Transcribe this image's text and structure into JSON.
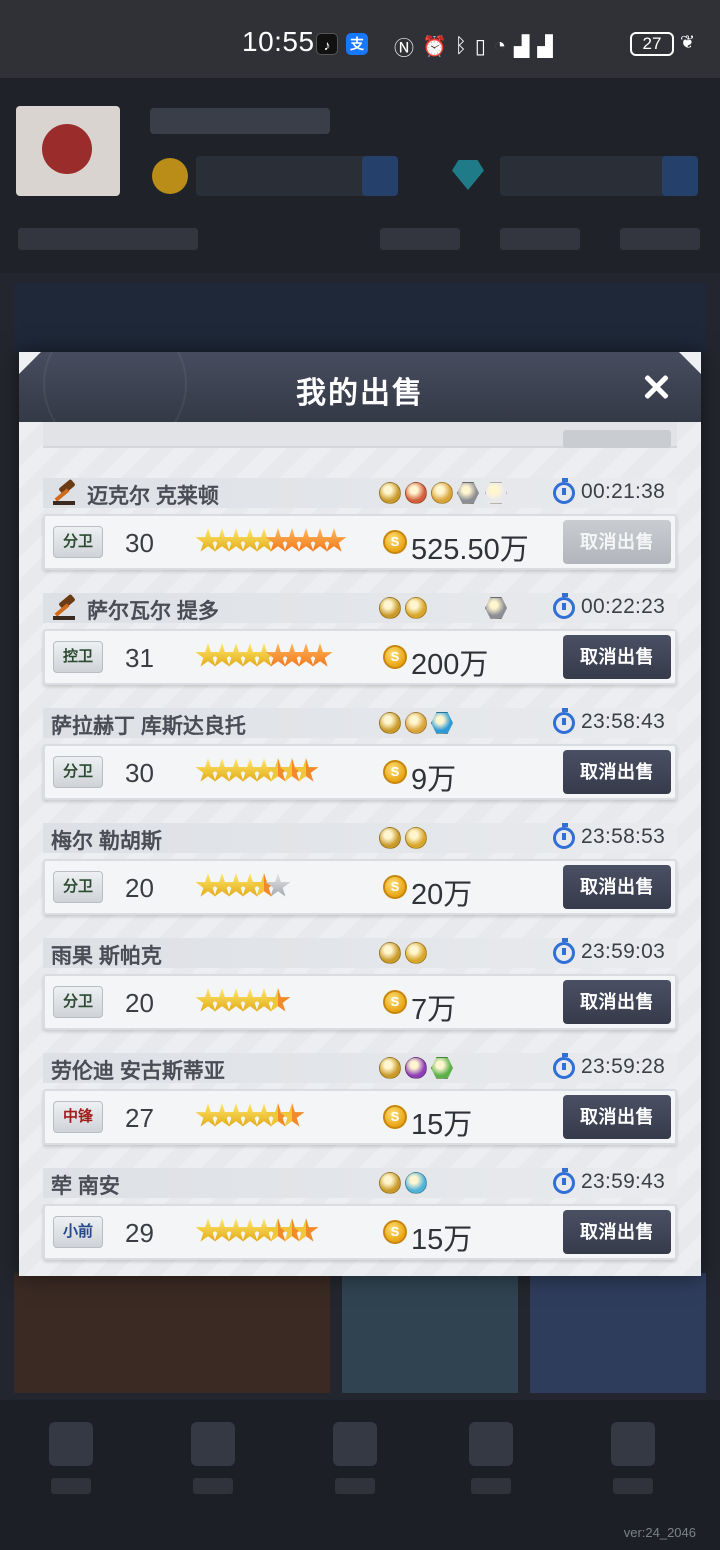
{
  "status_bar": {
    "time": "10:55",
    "battery": "27",
    "icons": [
      "nfc-icon",
      "alarm-icon",
      "bluetooth-icon",
      "vibrate-icon",
      "wifi-icon",
      "signal-5g-icon",
      "signal-icon"
    ]
  },
  "modal": {
    "title": "我的出售",
    "close_icon": "close-icon"
  },
  "listings": [
    {
      "name": "迈克尔 克莱顿",
      "auction": true,
      "badges": [
        "#c99a2a",
        "#d35d3a",
        "#d9a43a",
        "#8b8e94",
        "#e9e9ec"
      ],
      "time": "00:21:38",
      "position": "分卫",
      "position_color": "green",
      "level": "30",
      "stars": [
        "gold",
        "gold",
        "gold",
        "gold",
        "gold",
        "orange",
        "orange",
        "orange",
        "orange",
        "orange"
      ],
      "price": "525.50万",
      "button": "取消出售",
      "button_enabled": false
    },
    {
      "name": "萨尔瓦尔 提多",
      "auction": true,
      "badges": [
        "#c99a2a",
        "#d7a62a",
        "",
        "",
        "#8b8e94"
      ],
      "time": "00:22:23",
      "position": "控卫",
      "position_color": "green",
      "level": "31",
      "stars": [
        "gold",
        "gold",
        "gold",
        "gold",
        "gold",
        "orange",
        "orange",
        "orange",
        "orange"
      ],
      "price": "200万",
      "button": "取消出售",
      "button_enabled": true
    },
    {
      "name": "萨拉赫丁 库斯达良托",
      "auction": false,
      "badges": [
        "#c99a2a",
        "#d9a43a",
        "#2d9ad6"
      ],
      "time": "23:58:43",
      "position": "分卫",
      "position_color": "green",
      "level": "30",
      "stars": [
        "gold",
        "gold",
        "gold",
        "gold",
        "gold",
        "half",
        "half",
        "half"
      ],
      "price": "9万",
      "button": "取消出售",
      "button_enabled": true
    },
    {
      "name": "梅尔 勒胡斯",
      "auction": false,
      "badges": [
        "#c99a2a",
        "#d7a62a"
      ],
      "time": "23:58:53",
      "position": "分卫",
      "position_color": "green",
      "level": "20",
      "stars": [
        "gold",
        "gold",
        "gold",
        "gold",
        "half",
        "silver"
      ],
      "price": "20万",
      "button": "取消出售",
      "button_enabled": true
    },
    {
      "name": "雨果 斯帕克",
      "auction": false,
      "badges": [
        "#c99a2a",
        "#d7a62a"
      ],
      "time": "23:59:03",
      "position": "分卫",
      "position_color": "green",
      "level": "20",
      "stars": [
        "gold",
        "gold",
        "gold",
        "gold",
        "gold",
        "half"
      ],
      "price": "7万",
      "button": "取消出售",
      "button_enabled": true
    },
    {
      "name": "劳伦迪 安古斯蒂亚",
      "auction": false,
      "badges": [
        "#c99a2a",
        "#8d3fb5",
        "#5bb04a"
      ],
      "time": "23:59:28",
      "position": "中锋",
      "position_color": "red",
      "level": "27",
      "stars": [
        "gold",
        "gold",
        "gold",
        "gold",
        "gold",
        "half",
        "half"
      ],
      "price": "15万",
      "button": "取消出售",
      "button_enabled": true
    },
    {
      "name": "荦 南安",
      "auction": false,
      "badges": [
        "#c99a2a",
        "#4fb2d8"
      ],
      "time": "23:59:43",
      "position": "小前",
      "position_color": "blue",
      "level": "29",
      "stars": [
        "gold",
        "gold",
        "gold",
        "gold",
        "gold",
        "half",
        "half",
        "half"
      ],
      "price": "15万",
      "button": "取消出售",
      "button_enabled": true
    }
  ],
  "version": "ver:24_2046"
}
